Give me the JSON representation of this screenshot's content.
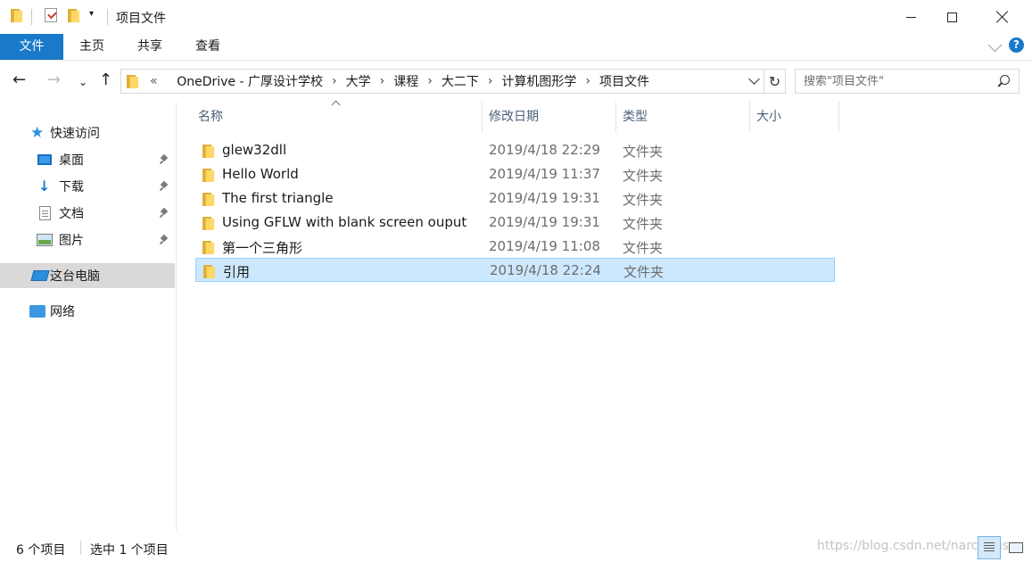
{
  "window": {
    "title": "项目文件"
  },
  "ribbon": {
    "tabs": [
      "文件",
      "主页",
      "共享",
      "查看"
    ]
  },
  "nav": {
    "breadcrumb": [
      "«",
      "OneDrive - 广厚设计学校",
      "大学",
      "课程",
      "大二下",
      "计算机图形学",
      "项目文件"
    ],
    "search_placeholder": "搜索\"项目文件\""
  },
  "sidebar": {
    "items": [
      {
        "label": "快速访问",
        "icon": "star-icon"
      },
      {
        "label": "桌面",
        "icon": "desktop-icon",
        "pinned": true
      },
      {
        "label": "下载",
        "icon": "download-icon",
        "pinned": true
      },
      {
        "label": "文档",
        "icon": "document-icon",
        "pinned": true
      },
      {
        "label": "图片",
        "icon": "pictures-icon",
        "pinned": true
      },
      {
        "label": "这台电脑",
        "icon": "computer-icon",
        "selected": true
      },
      {
        "label": "网络",
        "icon": "network-icon"
      }
    ]
  },
  "columns": [
    "名称",
    "修改日期",
    "类型",
    "大小"
  ],
  "files": [
    {
      "name": "glew32dll",
      "date": "2019/4/18 22:29",
      "type": "文件夹"
    },
    {
      "name": "Hello World",
      "date": "2019/4/19 11:37",
      "type": "文件夹"
    },
    {
      "name": "The first triangle",
      "date": "2019/4/19 19:31",
      "type": "文件夹"
    },
    {
      "name": "Using GFLW with blank screen ouput",
      "date": "2019/4/19 19:31",
      "type": "文件夹"
    },
    {
      "name": "第一个三角形",
      "date": "2019/4/19 11:08",
      "type": "文件夹"
    },
    {
      "name": "引用",
      "date": "2019/4/18 22:24",
      "type": "文件夹",
      "selected": true
    }
  ],
  "status": {
    "item_count": "6 个项目",
    "selection": "选中 1 个项目",
    "watermark": "https://blog.csdn.net/narcissus"
  },
  "colors": {
    "accent": "#1979ca",
    "selection": "#cce8ff",
    "folder": "#ffd766"
  }
}
